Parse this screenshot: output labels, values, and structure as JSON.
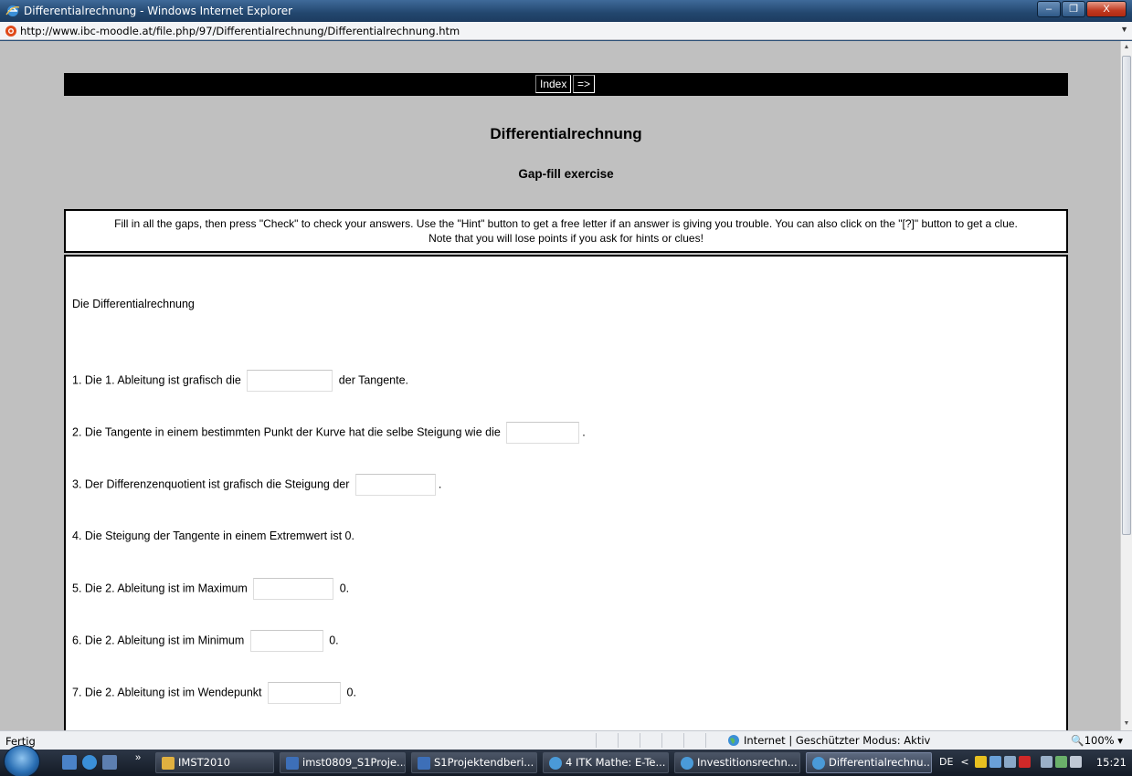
{
  "window": {
    "title": "Differentialrechnung - Windows Internet Explorer",
    "url": "http://www.ibc-moodle.at/file.php/97/Differentialrechnung/Differentialrechnung.htm",
    "buttons": {
      "minimize": "–",
      "maximize": "❐",
      "close": "X"
    }
  },
  "page": {
    "nav": {
      "index_label": "Index",
      "next_label": "=>"
    },
    "title": "Differentialrechnung",
    "subtitle": "Gap-fill exercise",
    "instructions_line1": "Fill in all the gaps, then press \"Check\" to check your answers. Use the \"Hint\" button to get a free letter if an answer is giving you trouble. You can also click on the \"[?]\" button to get a clue.",
    "instructions_line2": "Note that you will lose points if you ask for hints or clues!",
    "intro": "Die Differentialrechnung",
    "questions": [
      {
        "before": "1. Die 1. Ableitung ist grafisch die",
        "after": "der Tangente."
      },
      {
        "before": "2. Die Tangente in einem bestimmten Punkt der Kurve hat die selbe Steigung wie die",
        "after": "."
      },
      {
        "before": "3. Der Differenzenquotient ist grafisch die Steigung der",
        "after": "."
      },
      {
        "before": "4. Die Steigung der Tangente in einem Extremwert ist 0.",
        "after": ""
      },
      {
        "before": "5. Die 2. Ableitung ist im Maximum",
        "after": "0."
      },
      {
        "before": "6. Die 2. Ableitung ist im Minimum",
        "after": "0."
      },
      {
        "before": "7. Die 2. Ableitung ist im Wendepunkt",
        "after": "0."
      }
    ]
  },
  "statusbar": {
    "status": "Fertig",
    "zone": "Internet | Geschützter Modus: Aktiv",
    "zoom": "🔍100%  ▾"
  },
  "taskbar": {
    "chevron": "»",
    "tasks": [
      {
        "label": "IMST2010",
        "color": "#e0b040"
      },
      {
        "label": "imst0809_S1Proje...",
        "color": "#3d6fb8"
      },
      {
        "label": "S1Projektendberi...",
        "color": "#3d6fb8"
      },
      {
        "label": "4 ITK Mathe: E-Te...",
        "color": "#4a9ad8"
      },
      {
        "label": "Investitionsrechn...",
        "color": "#4a9ad8"
      },
      {
        "label": "Differentialrechnu...",
        "color": "#4a9ad8"
      }
    ],
    "language": "DE",
    "tray_arrow": "<",
    "clock": "15:21"
  },
  "colors": {
    "page_background": "#c0c0c0",
    "nav_bar": "#000000",
    "title_bar": "#22466e"
  }
}
